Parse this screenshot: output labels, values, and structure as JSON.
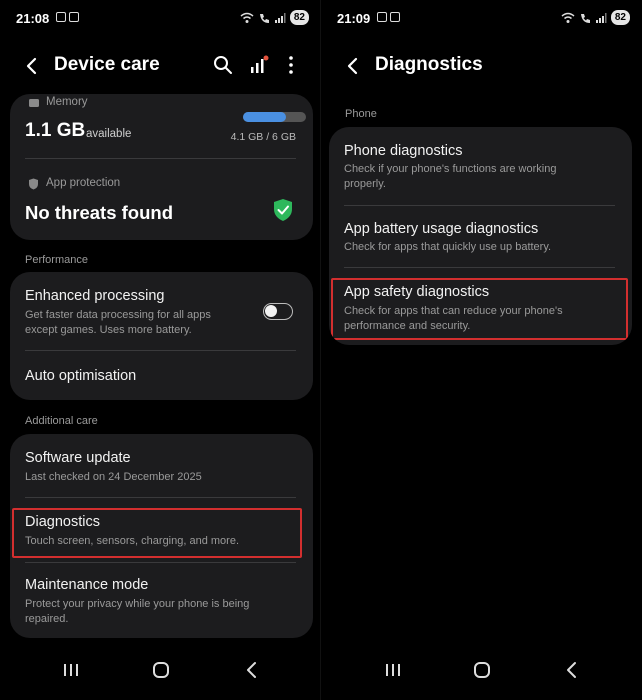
{
  "left": {
    "status": {
      "time": "21:08",
      "battery": "82"
    },
    "header": {
      "title": "Device care"
    },
    "memory": {
      "label": "Memory",
      "value": "1.1 GB",
      "value_suffix": "available",
      "usage": "4.1 GB / 6 GB",
      "fill_fraction": 0.68
    },
    "protection": {
      "label": "App protection",
      "status": "No threats found"
    },
    "performance": {
      "label": "Performance",
      "enhanced_title": "Enhanced processing",
      "enhanced_sub_line1": "Get faster data processing for all apps",
      "enhanced_sub_line2": "except games. Uses more battery.",
      "auto_title": "Auto optimisation"
    },
    "additional": {
      "label": "Additional care",
      "software_title": "Software update",
      "software_sub": "Last checked on 24 December 2025",
      "diag_title": "Diagnostics",
      "diag_sub": "Touch screen, sensors, charging, and more.",
      "maint_title": "Maintenance mode",
      "maint_sub_line1": "Protect your privacy while your phone is being",
      "maint_sub_line2": "repaired."
    }
  },
  "right": {
    "status": {
      "time": "21:09",
      "battery": "82"
    },
    "header": {
      "title": "Diagnostics"
    },
    "section": "Phone",
    "items": [
      {
        "title": "Phone diagnostics",
        "sub_line1": "Check if your phone's functions are working",
        "sub_line2": "properly."
      },
      {
        "title": "App battery usage diagnostics",
        "sub_line1": "Check for apps that quickly use up battery.",
        "sub_line2": ""
      },
      {
        "title": "App safety diagnostics",
        "sub_line1": "Check for apps that can reduce your phone's",
        "sub_line2": "performance and security."
      }
    ]
  },
  "colors": {
    "card": "#1c1c1e",
    "accent_blue": "#4a90e2",
    "shield_green": "#2eb85c",
    "highlight_red": "#d32f2f"
  }
}
